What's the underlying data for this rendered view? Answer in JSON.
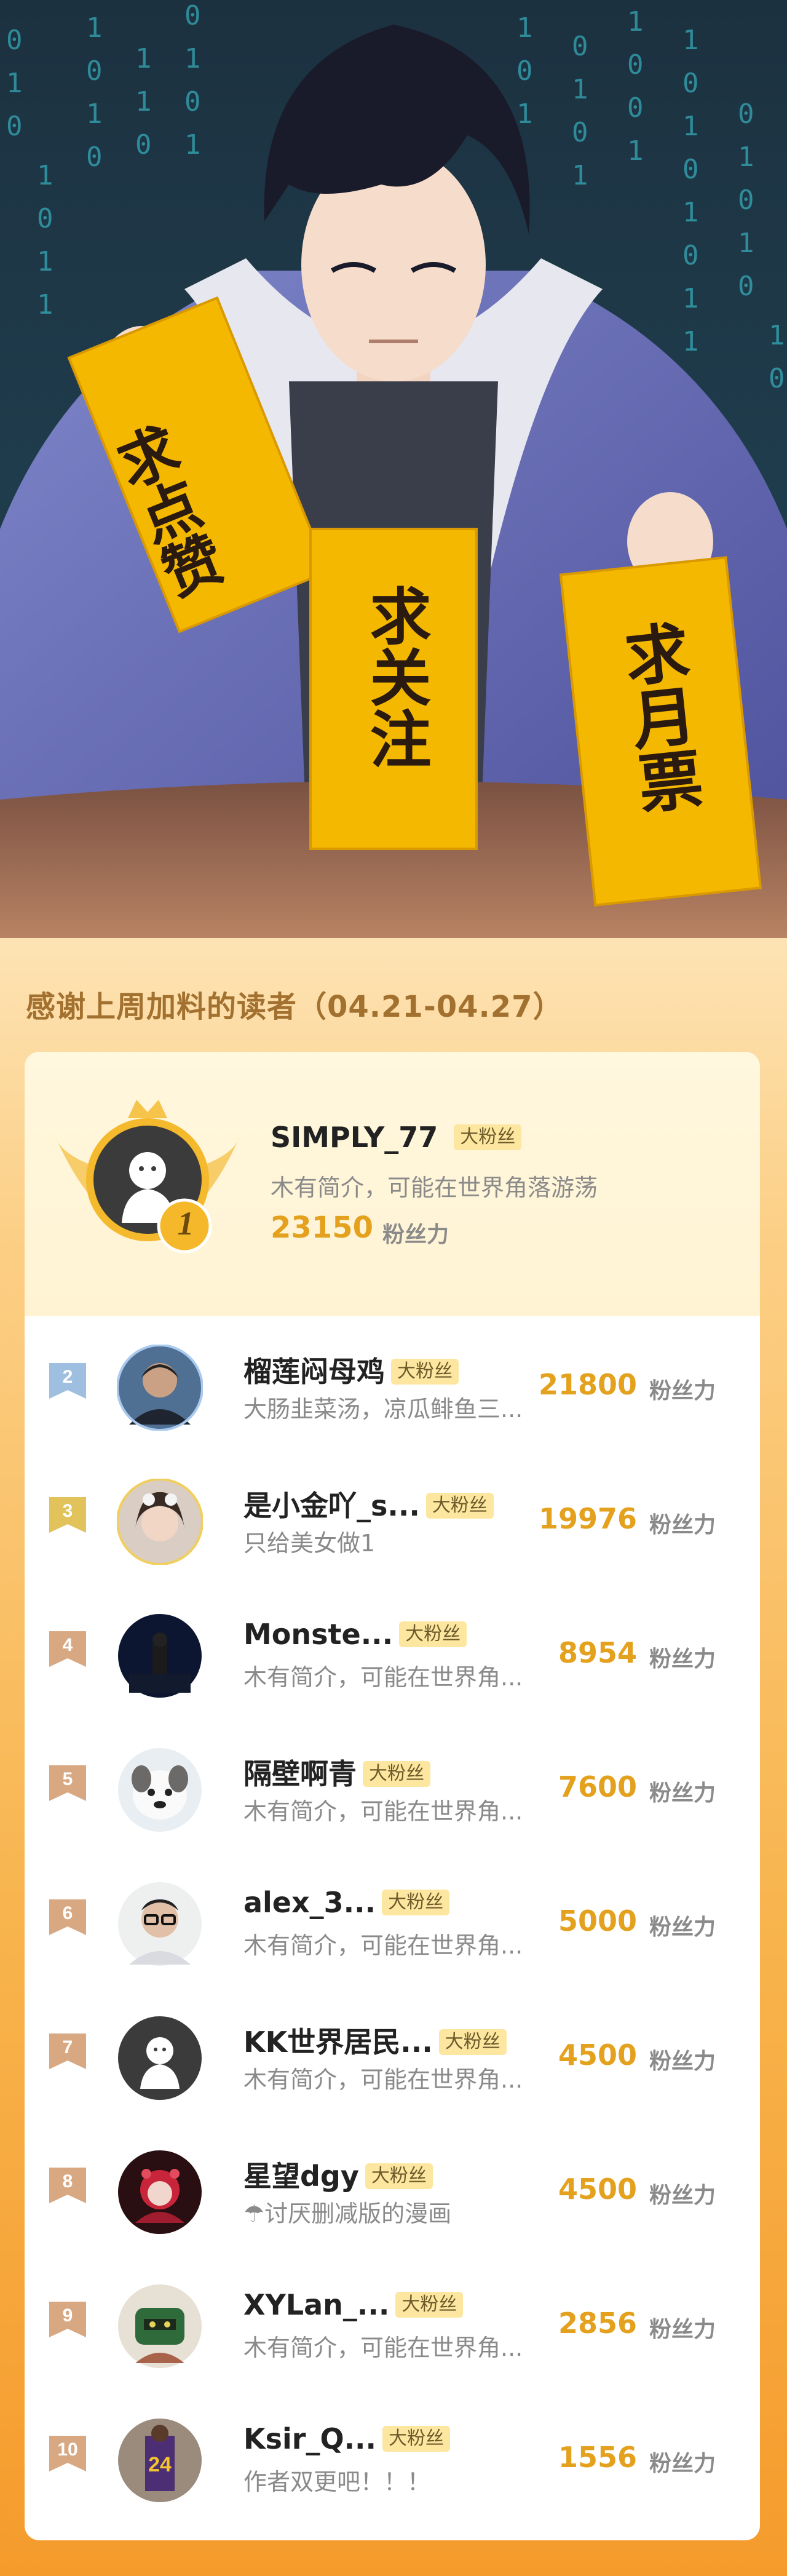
{
  "banner": {
    "signs": [
      "求点赞",
      "求关注",
      "求月票"
    ],
    "code_rain_digits": "10"
  },
  "section": {
    "title": "感谢上周加料的读者（04.21-04.27）"
  },
  "fan_tag": "大粉丝",
  "score_unit": "粉丝力",
  "colors": {
    "accent": "#e3a11e",
    "tag_bg": "#fde7a0",
    "title": "#a3712f",
    "rank_badge": "#d8a882"
  },
  "top1": {
    "rank": "1",
    "name": "SIMPLY_77",
    "intro": "木有简介，可能在世界角落游荡",
    "score": "23150"
  },
  "rows": [
    {
      "rank": "2",
      "name": "榴莲闷母鸡",
      "intro": "大肠韭菜汤，凉瓜鲱鱼三...",
      "score": "21800",
      "avatar": "photo-man"
    },
    {
      "rank": "3",
      "name": "是小金吖_s...",
      "intro": "只给美女做1",
      "score": "19976",
      "avatar": "photo-girl"
    },
    {
      "rank": "4",
      "name": "Monste...",
      "intro": "木有简介，可能在世界角...",
      "score": "8954",
      "avatar": "photo-dark"
    },
    {
      "rank": "5",
      "name": "隔壁啊青",
      "intro": "木有简介，可能在世界角...",
      "score": "7600",
      "avatar": "photo-dog"
    },
    {
      "rank": "6",
      "name": "alex_3...",
      "intro": "木有简介，可能在世界角...",
      "score": "5000",
      "avatar": "photo-glasses"
    },
    {
      "rank": "7",
      "name": "KK世界居民...",
      "intro": "木有简介，可能在世界角...",
      "score": "4500",
      "avatar": "default"
    },
    {
      "rank": "8",
      "name": "星望dgy",
      "intro": "☂讨厌删减版的漫画",
      "score": "4500",
      "avatar": "photo-red"
    },
    {
      "rank": "9",
      "name": "XYLan_...",
      "intro": "木有简介，可能在世界角...",
      "score": "2856",
      "avatar": "photo-green"
    },
    {
      "rank": "10",
      "name": "Ksir_Q...",
      "intro": "作者双更吧！！！",
      "score": "1556",
      "avatar": "photo-basketball"
    }
  ]
}
